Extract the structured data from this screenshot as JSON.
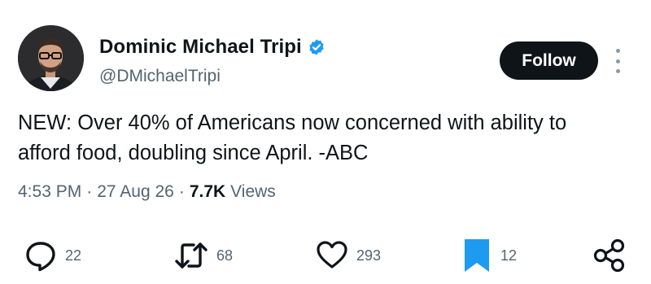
{
  "author": {
    "display_name": "Dominic Michael Tripi",
    "handle": "@DMichaelTripi",
    "verified_icon": "verified-badge-icon",
    "verified_color": "#1d9bf0"
  },
  "follow": {
    "label": "Follow"
  },
  "tweet": {
    "text_line1": "NEW: Over 40% of Americans now concerned with ability to",
    "text_line2": "afford food, doubling since April. -ABC"
  },
  "meta": {
    "time": "4:53 PM",
    "separator": "·",
    "date": "27 Aug 26",
    "views_count": "7.7K",
    "views_label": "Views"
  },
  "actions": {
    "reply": {
      "icon": "reply-bubble-icon",
      "count": "22"
    },
    "retweet": {
      "icon": "retweet-icon",
      "count": "68"
    },
    "like": {
      "icon": "heart-icon",
      "count": "293"
    },
    "bookmark": {
      "icon": "bookmark-icon",
      "count": "12",
      "color": "#1d9bf0"
    },
    "share": {
      "icon": "share-icon"
    }
  },
  "colors": {
    "text_primary": "#0f1419",
    "text_secondary": "#536471",
    "accent": "#1d9bf0",
    "follow_bg": "#0f1419"
  }
}
